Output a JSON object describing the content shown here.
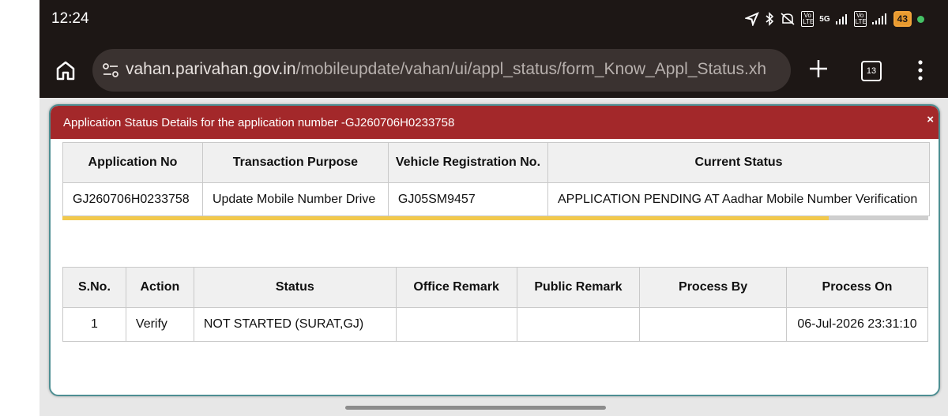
{
  "statusbar": {
    "time": "12:24",
    "network": "5G",
    "lte_1": "Vo LTE",
    "lte_2": "Vo LTE",
    "battery": "43"
  },
  "browser": {
    "url_domain": "vahan.parivahan.gov.in",
    "url_path": "/mobileupdate/vahan/ui/appl_status/form_Know_Appl_Status.xh",
    "tab_count": "13"
  },
  "dialog": {
    "title": "Application Status Details for the application number -GJ260706H0233758",
    "close": "×",
    "progress_fraction": 0.885
  },
  "application_table": {
    "headers": [
      "Application No",
      "Transaction Purpose",
      "Vehicle Registration No.",
      "Current Status"
    ],
    "row": [
      "GJ260706H0233758",
      "Update Mobile Number Drive",
      "GJ05SM9457",
      "APPLICATION PENDING AT Aadhar Mobile Number Verification"
    ]
  },
  "history_table": {
    "headers": [
      "S.No.",
      "Action",
      "Status",
      "Office Remark",
      "Public Remark",
      "Process By",
      "Process On"
    ],
    "rows": [
      [
        "1",
        "Verify",
        "NOT STARTED (SURAT,GJ)",
        "",
        "",
        "",
        "06-Jul-2026 23:31:10"
      ]
    ]
  },
  "colors": {
    "header_red": "#a3282a",
    "dialog_border": "#4e8f93",
    "progress": "#f2c94c"
  }
}
